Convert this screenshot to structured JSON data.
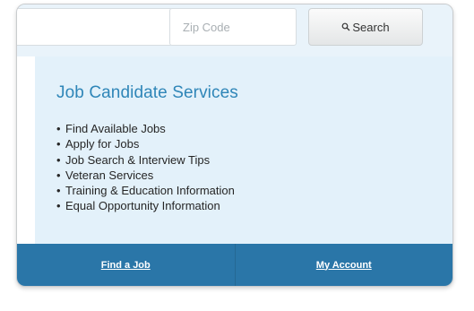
{
  "search": {
    "keyword_value": "",
    "zip_placeholder": "Zip Code",
    "button_label": "Search"
  },
  "section": {
    "title": "Job Candidate Services",
    "items": [
      "Find Available Jobs",
      "Apply for Jobs",
      "Job Search & Interview Tips",
      "Veteran Services",
      "Training & Education Information",
      "Equal Opportunity Information"
    ]
  },
  "footer": {
    "links": [
      "Find a Job",
      "My Account"
    ]
  },
  "icons": {
    "search": "search-icon"
  },
  "colors": {
    "panel_background": "#e3f1fa",
    "heading": "#2f86b8",
    "footer_bar": "#2a76a8"
  }
}
